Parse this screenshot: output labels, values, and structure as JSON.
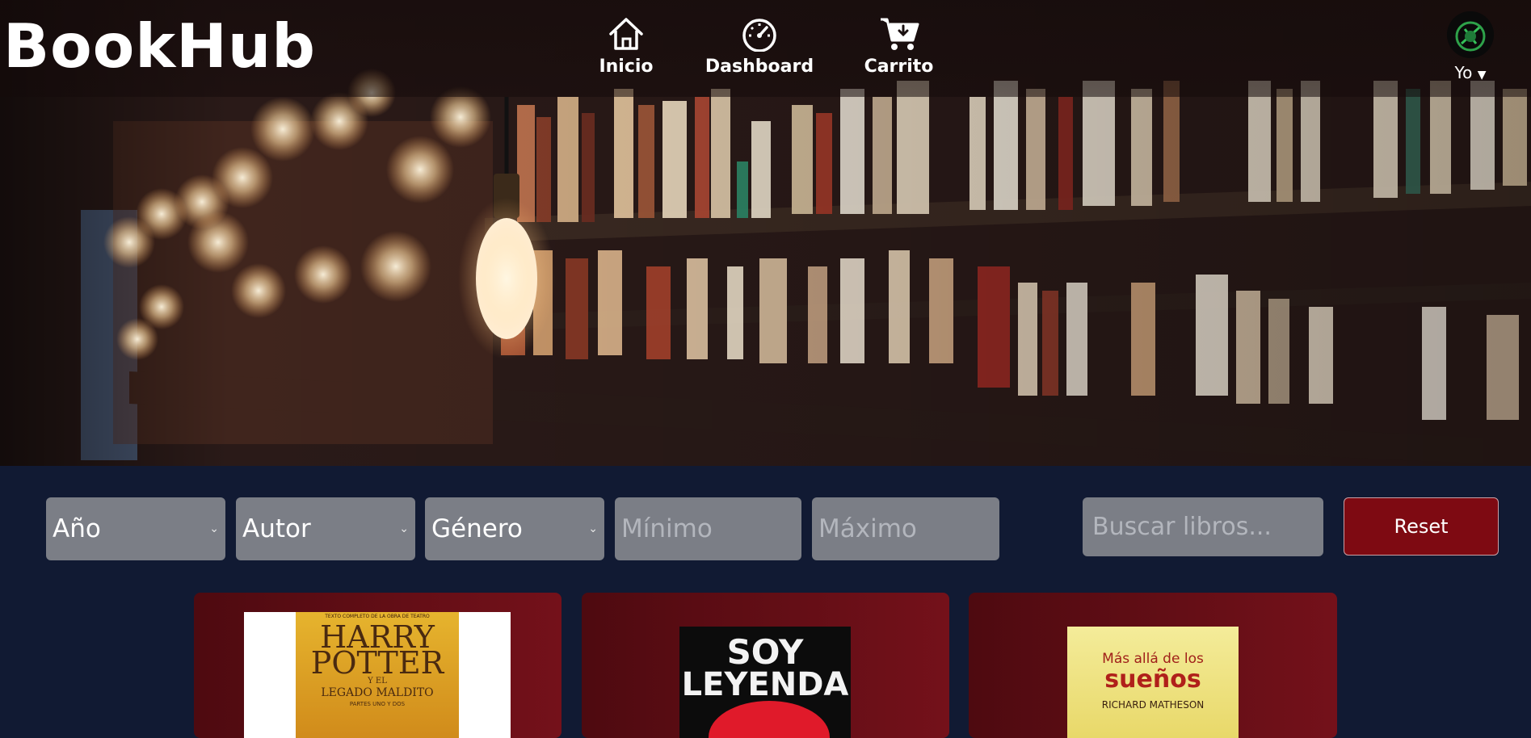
{
  "brand": {
    "name": "BookHub"
  },
  "nav": {
    "home": {
      "label": "Inicio",
      "icon": "home-icon"
    },
    "dashboard": {
      "label": "Dashboard",
      "icon": "speedometer-icon"
    },
    "cart": {
      "label": "Carrito",
      "icon": "shopping-cart-icon"
    }
  },
  "user": {
    "label": "Yo",
    "icon": "caret-down-icon",
    "avatar": "avatar"
  },
  "filters": {
    "year": {
      "value": "Año"
    },
    "author": {
      "value": "Autor"
    },
    "genre": {
      "value": "Género"
    },
    "min_price": {
      "placeholder": "Mínimo"
    },
    "max_price": {
      "placeholder": "Máximo"
    },
    "search": {
      "placeholder": "Buscar libros..."
    },
    "reset_label": "Reset"
  },
  "books": [
    {
      "cover_small": "TEXTO COMPLETO DE LA OBRA DE TEATRO",
      "cover_title_1": "HARRY",
      "cover_title_2": "POTTER",
      "cover_sub": "Y EL",
      "cover_sub2": "LEGADO MALDITO",
      "cover_parts": "PARTES UNO Y DOS"
    },
    {
      "cover_title_1": "SOY",
      "cover_title_2": "LEYENDA"
    },
    {
      "cover_title_1": "Más allá de los",
      "cover_title_2": "sueños",
      "cover_author": "RICHARD MATHESON"
    }
  ],
  "colors": {
    "page_bg": "#111a33",
    "reset_bg": "#7e0a12",
    "card_bg": "#74111a",
    "field_bg": "#7b7e86"
  }
}
